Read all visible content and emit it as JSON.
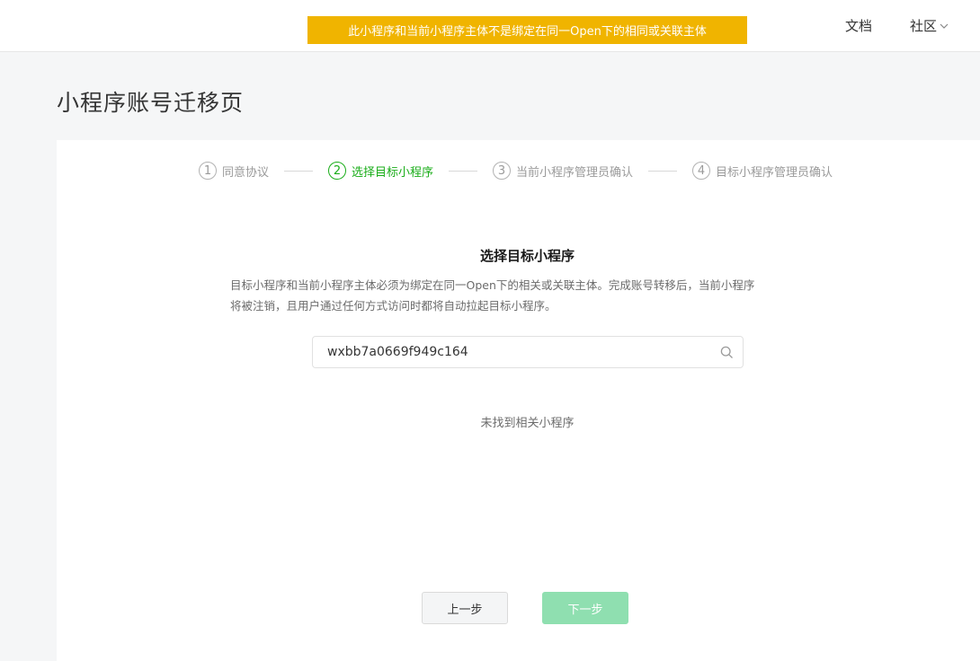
{
  "header": {
    "banner_text": "此小程序和当前小程序主体不是绑定在同一Open下的相同或关联主体",
    "banner_color": "#f0b400",
    "nav_docs": "文档",
    "nav_community": "社区"
  },
  "page": {
    "title": "小程序账号迁移页"
  },
  "steps": [
    {
      "num": "1",
      "label": "同意协议",
      "state": "done"
    },
    {
      "num": "2",
      "label": "选择目标小程序",
      "state": "active"
    },
    {
      "num": "3",
      "label": "当前小程序管理员确认",
      "state": "pending"
    },
    {
      "num": "4",
      "label": "目标小程序管理员确认",
      "state": "pending"
    }
  ],
  "main": {
    "section_title": "选择目标小程序",
    "description_line1": "目标小程序和当前小程序主体必须为绑定在同一Open下的相关或关联主体。完成账号转移后，当前小程序",
    "description_line2": "将被注销，且用户通过任何方式访问时都将自动拉起目标小程序。",
    "search": {
      "value": "wxbb7a0669f949c164",
      "icon": "search-icon"
    },
    "empty_text": "未找到相关小程序"
  },
  "footer": {
    "prev_label": "上一步",
    "next_label": "下一步",
    "accent_color": "#1aad19"
  }
}
